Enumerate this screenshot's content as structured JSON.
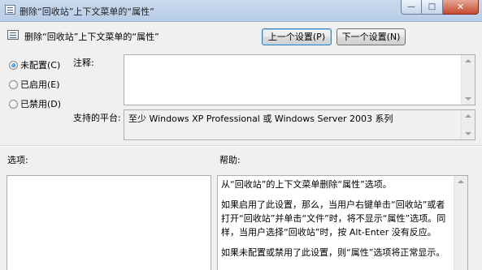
{
  "window": {
    "title": "删除“回收站”上下文菜单的“属性”",
    "controls": {
      "minimize": "—",
      "maximize": "□",
      "close": "✕"
    }
  },
  "setting": {
    "name": "删除“回收站”上下文菜单的“属性”"
  },
  "nav": {
    "prev_label": "上一个设置(P)",
    "next_label": "下一个设置(N)"
  },
  "state": {
    "options": [
      {
        "label": "未配置(C)",
        "checked": true
      },
      {
        "label": "已启用(E)",
        "checked": false
      },
      {
        "label": "已禁用(D)",
        "checked": false
      }
    ]
  },
  "comment": {
    "label": "注释:",
    "value": ""
  },
  "supported": {
    "label": "支持的平台:",
    "value": "至少 Windows XP Professional 或 Windows Server 2003 系列"
  },
  "options_panel": {
    "label": "选项:"
  },
  "help_panel": {
    "label": "帮助:",
    "paragraphs": [
      "从“回收站”的上下文菜单删除“属性”选项。",
      "如果启用了此设置，那么，当用户右键单击“回收站”或者打开“回收站”并单击“文件”时，将不显示“属性”选项。同样，当用户选择“回收站”时，按 Alt-Enter 没有反应。",
      "如果未配置或禁用了此设置，则“属性”选项将正常显示。"
    ]
  }
}
